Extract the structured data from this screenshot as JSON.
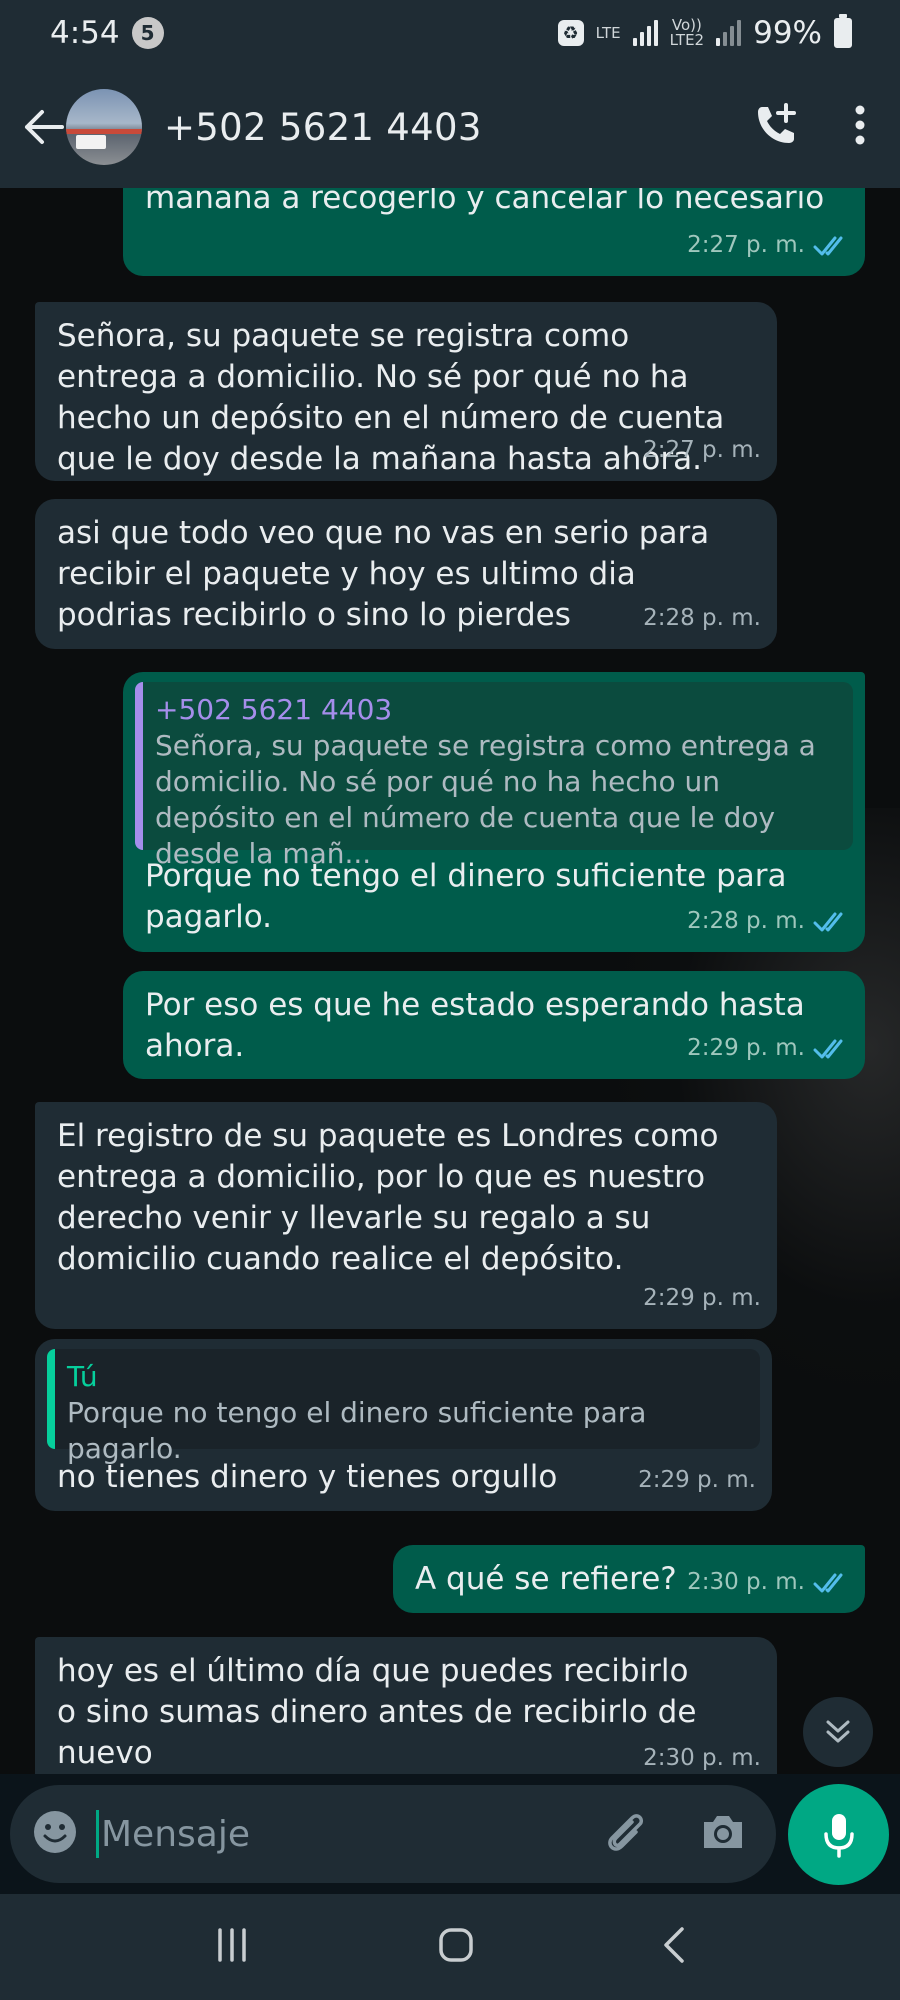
{
  "status_bar": {
    "time": "4:54",
    "notification_count": "5",
    "network_top": "LTE",
    "network_bottom": "Vo))\nLTE2",
    "battery": "99%"
  },
  "header": {
    "contact_name": "+502 5621 4403"
  },
  "messages": [
    {
      "direction": "out",
      "text": "mañana a recogerlo y cancelar lo necesario",
      "time": "2:27 p. m."
    },
    {
      "direction": "in",
      "text": "Señora, su paquete se registra como entrega a domicilio. No sé por qué no ha hecho un depósito en el número de cuenta que le doy desde la mañana hasta ahora.",
      "time": "2:27 p. m."
    },
    {
      "direction": "in",
      "text": "asi que todo veo que no vas en serio para recibir el paquete y hoy es ultimo dia podrias recibirlo o sino lo pierdes",
      "time": "2:28 p. m."
    },
    {
      "direction": "out",
      "quote_author": "+502 5621 4403",
      "quote_text": "Señora, su paquete se registra como entrega a domicilio. No sé por qué no ha hecho un depósito en el número de cuenta que le doy desde la mañ...",
      "text": "Porque no tengo el dinero suficiente para pagarlo.",
      "time": "2:28 p. m."
    },
    {
      "direction": "out",
      "text": "Por eso es que he estado esperando hasta ahora.",
      "time": "2:29 p. m."
    },
    {
      "direction": "in",
      "text": "El registro de su paquete es Londres como entrega a domicilio, por lo que es nuestro derecho venir y llevarle su regalo a su domicilio cuando realice el depósito.",
      "time": "2:29 p. m."
    },
    {
      "direction": "in",
      "quote_author": "Tú",
      "quote_text": "Porque no tengo el dinero suficiente para pagarlo.",
      "text": "no tienes dinero y tienes orgullo",
      "time": "2:29 p. m."
    },
    {
      "direction": "out",
      "text": "A qué se refiere?",
      "time": "2:30 p. m."
    },
    {
      "direction": "in",
      "text": "hoy es el último día que puedes recibirlo o sino sumas dinero antes de recibirlo de nuevo",
      "time": "2:30 p. m."
    }
  ],
  "input": {
    "placeholder": "Mensaje"
  },
  "icons": {
    "back": "arrow-left-icon",
    "call": "add-call-icon",
    "menu": "more-vert-icon",
    "emoji": "emoji-icon",
    "attach": "paperclip-icon",
    "camera": "camera-icon",
    "mic": "mic-icon",
    "scroll": "chevron-double-down-icon"
  },
  "colors": {
    "incoming_bubble": "#1f2c34",
    "outgoing_bubble": "#005c4b",
    "accent": "#00a884",
    "read_ticks": "#53bdeb"
  }
}
